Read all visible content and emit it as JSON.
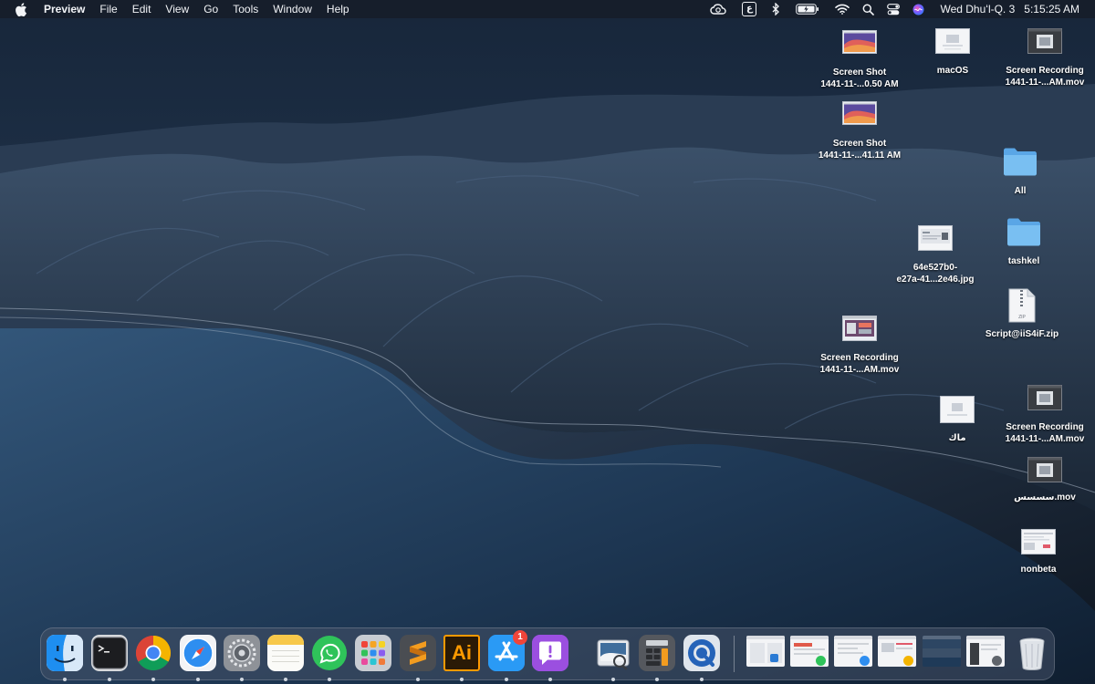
{
  "menubar": {
    "app_name": "Preview",
    "menus": [
      "File",
      "Edit",
      "View",
      "Go",
      "Tools",
      "Window",
      "Help"
    ],
    "status_icons": [
      "creative-cloud-icon",
      "input-source-icon",
      "bluetooth-icon",
      "battery-icon",
      "wifi-icon",
      "spotlight-icon",
      "control-center-icon",
      "siri-icon"
    ],
    "input_source_glyph": "ع",
    "date": "Wed Dhuʻl-Q. 3",
    "time": "5:15:25 AM"
  },
  "desktop_icons": [
    {
      "name": "screenshot-file-1",
      "line1": "Screen Shot",
      "line2": "1441-11-...0.50 AM",
      "kind": "screenshot"
    },
    {
      "name": "macos-file",
      "line1": "macOS",
      "line2": "",
      "kind": "document"
    },
    {
      "name": "screen-recording-file-1",
      "line1": "Screen Recording",
      "line2": "1441-11-...AM.mov",
      "kind": "video"
    },
    {
      "name": "screenshot-file-2",
      "line1": "Screen Shot",
      "line2": "1441-11-...41.11 AM",
      "kind": "screenshot"
    },
    {
      "name": "folder-all",
      "line1": "All",
      "line2": "",
      "kind": "folder"
    },
    {
      "name": "image-file-64e527b0",
      "line1": "64e527b0-",
      "line2": "e27a-41...2e46.jpg",
      "kind": "image"
    },
    {
      "name": "folder-tashkel",
      "line1": "tashkel",
      "line2": "",
      "kind": "folder"
    },
    {
      "name": "zip-file-script",
      "line1": "Script@iiS4iF.zip",
      "line2": "",
      "kind": "zip",
      "badge": "ZIP"
    },
    {
      "name": "screen-recording-file-2",
      "line1": "Screen Recording",
      "line2": "1441-11-...AM.mov",
      "kind": "video-color"
    },
    {
      "name": "arabic-named-file",
      "line1": "ماك",
      "line2": "",
      "kind": "document"
    },
    {
      "name": "screen-recording-file-3",
      "line1": "Screen Recording",
      "line2": "1441-11-...AM.mov",
      "kind": "video"
    },
    {
      "name": "arabic-mov-file",
      "line1": "سسسس.mov",
      "line2": "",
      "kind": "video"
    },
    {
      "name": "nonbeta-file",
      "line1": "nonbeta",
      "line2": "",
      "kind": "document"
    }
  ],
  "dock": {
    "apps": [
      {
        "name": "finder",
        "running": true
      },
      {
        "name": "terminal",
        "running": true
      },
      {
        "name": "chrome",
        "running": true
      },
      {
        "name": "safari",
        "running": true
      },
      {
        "name": "system-preferences",
        "running": true
      },
      {
        "name": "notes",
        "running": true
      },
      {
        "name": "whatsapp",
        "running": true
      },
      {
        "name": "launchpad",
        "running": false
      },
      {
        "name": "sublime-text",
        "running": true
      },
      {
        "name": "illustrator",
        "running": true,
        "label": "Ai"
      },
      {
        "name": "app-store",
        "running": true,
        "badge": "1"
      },
      {
        "name": "feedback-assistant",
        "running": true
      },
      {
        "name": "preview",
        "running": true
      },
      {
        "name": "calculator",
        "running": true
      },
      {
        "name": "quicktime",
        "running": true
      }
    ],
    "minimized_windows": 6,
    "trash": "trash"
  },
  "colors": {
    "folder": "#6fb8ef",
    "accent_red": "#f0453a",
    "menubar_bg": "#161c26",
    "sea": "#1f3a58",
    "mountains": "#2b3b52"
  }
}
